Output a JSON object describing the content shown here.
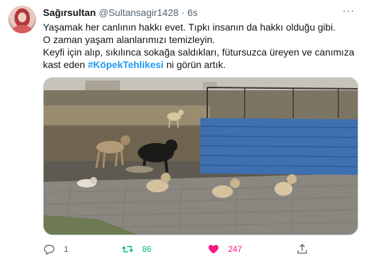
{
  "tweet": {
    "display_name": "Sağırsultan",
    "handle": "@Sultansagir1428",
    "separator": "·",
    "time": "6s",
    "more_label": "···",
    "text": {
      "line1": "Yaşamak her canlının hakkı evet. Tıpkı insanın da hakkı olduğu gibi.",
      "line2": "O zaman yaşam alanlarımızı temizleyin.",
      "line3": "Keyfi için alıp, sıkılınca sokağa saldıkları, fütursuzca üreyen ve canımıza",
      "line4_before": "kast eden ",
      "hashtag": "#KöpekTehlikesi",
      "line4_after": " ni görün artık."
    },
    "counts": {
      "reply": "1",
      "retweet": "86",
      "like": "247"
    },
    "state": {
      "retweeted": true,
      "liked": true
    }
  },
  "colors": {
    "text": "#0f1419",
    "secondary": "#536471",
    "hashtag": "#1d9bf0",
    "retweet": "#00ba7c",
    "like": "#f91880",
    "border": "#cfd9de"
  },
  "icons": {
    "reply": "speech-bubble-icon",
    "retweet": "retweet-arrows-icon",
    "like": "heart-icon",
    "share": "upload-arrow-icon",
    "more": "ellipsis-icon"
  }
}
